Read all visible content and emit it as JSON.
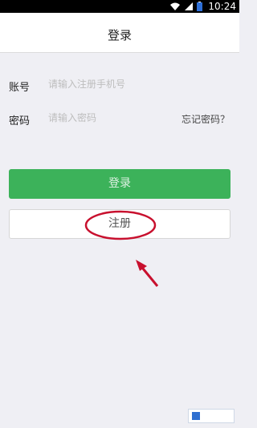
{
  "status_bar": {
    "time": "10:24"
  },
  "header": {
    "title": "登录"
  },
  "form": {
    "account_label": "账号",
    "account_placeholder": "请输入注册手机号",
    "password_label": "密码",
    "password_placeholder": "请输入密码",
    "forgot_label": "忘记密码？"
  },
  "actions": {
    "login_label": "登录",
    "register_label": "注册"
  },
  "colors": {
    "primary_green": "#3cb25a",
    "annotation_red": "#c8102e"
  }
}
